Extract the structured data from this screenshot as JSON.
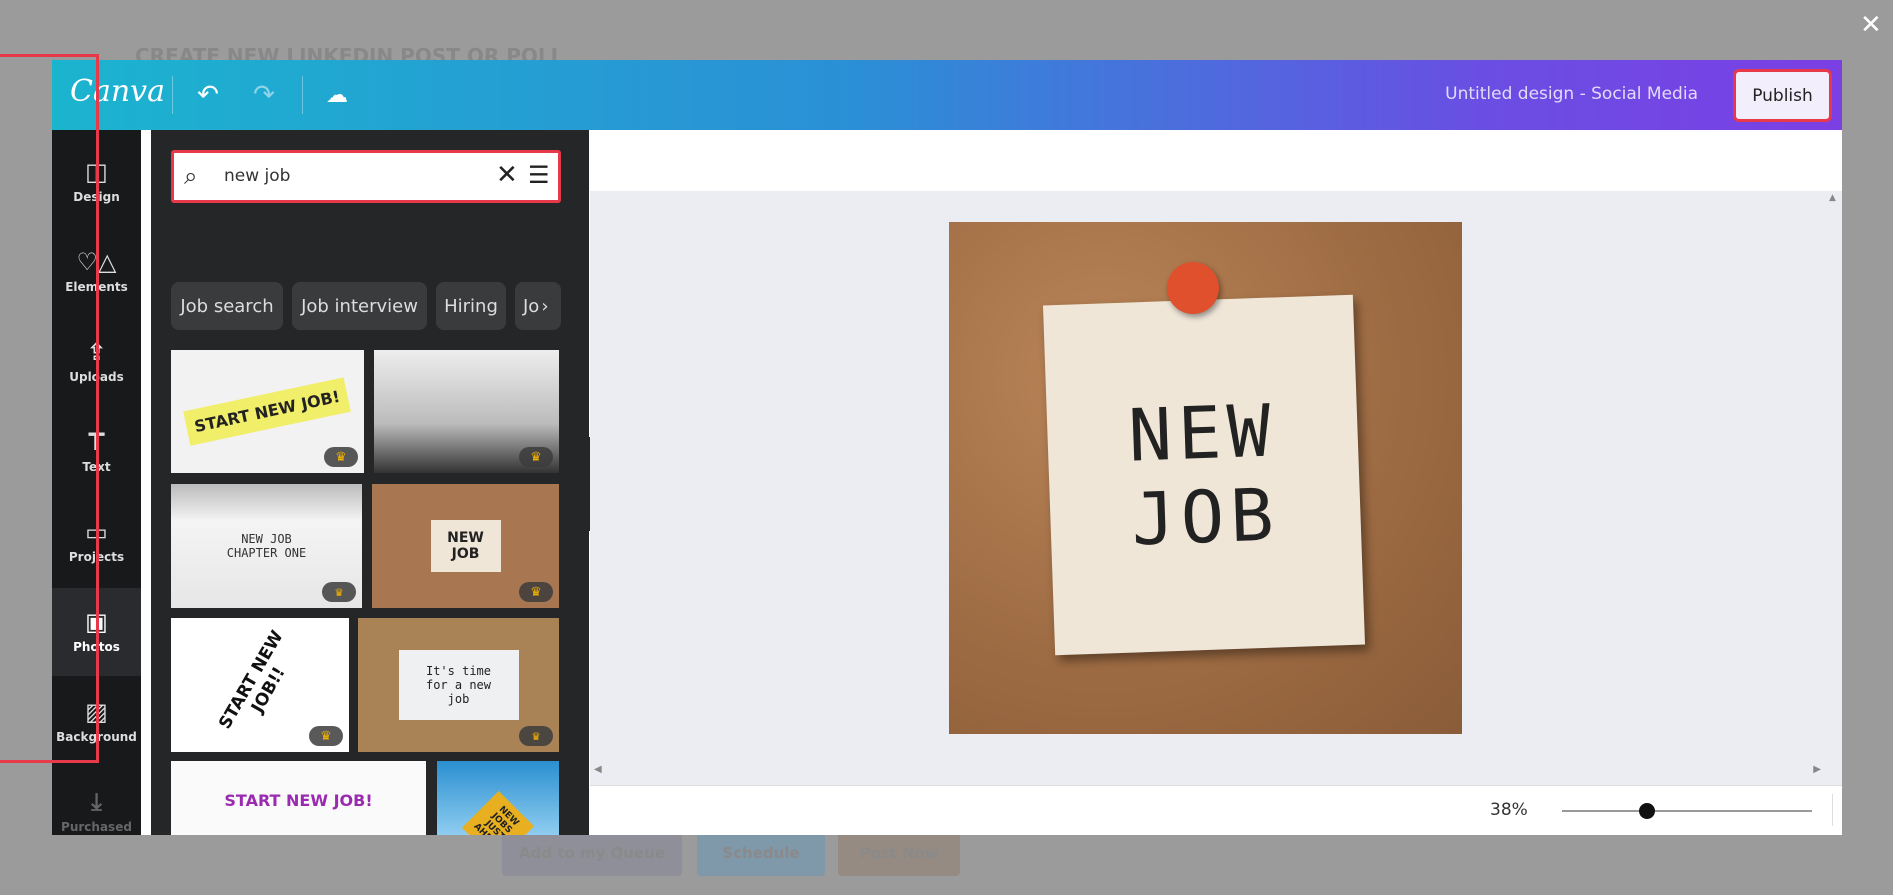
{
  "background_app": {
    "page_title": "CREATE NEW LINKEDIN POST OR POLL",
    "buttons": [
      "Add to my Queue",
      "Schedule",
      "Post Now"
    ]
  },
  "close_icon": "close-icon",
  "header": {
    "logo": "Canva",
    "title": "Untitled design - Social Media",
    "publish": "Publish",
    "icons": [
      "undo-icon",
      "redo-icon",
      "cloud-saved-icon"
    ]
  },
  "rail": {
    "items": [
      {
        "label": "Design",
        "icon": "layout-icon"
      },
      {
        "label": "Elements",
        "icon": "shapes-icon"
      },
      {
        "label": "Uploads",
        "icon": "cloud-upload-icon"
      },
      {
        "label": "Text",
        "icon": "text-icon"
      },
      {
        "label": "Projects",
        "icon": "folder-icon"
      },
      {
        "label": "Photos",
        "icon": "image-icon",
        "active": true
      },
      {
        "label": "Background",
        "icon": "stripes-icon"
      },
      {
        "label": "Purchased",
        "icon": "download-icon"
      }
    ]
  },
  "search": {
    "value": "new job",
    "icons": [
      "search-icon",
      "clear-icon",
      "filter-icon"
    ]
  },
  "chips": [
    "Job search",
    "Job interview",
    "Hiring",
    "Jo"
  ],
  "photos": [
    {
      "text": "START NEW JOB!",
      "premium": true
    },
    {
      "text": "",
      "premium": true
    },
    {
      "text": "NEW JOB CHAPTER ONE",
      "premium": true
    },
    {
      "text": "NEW JOB",
      "premium": true
    },
    {
      "text": "START NEW JOB!!",
      "premium": true
    },
    {
      "text": "It's time for a new job",
      "premium": true
    },
    {
      "text": "START NEW JOB!",
      "premium": false
    },
    {
      "text": "NEW JOBS JUST AHEAD",
      "premium": false
    }
  ],
  "canvas": {
    "note_line1": "NEW",
    "note_line2": "JOB"
  },
  "bottom": {
    "zoom": "38%",
    "zoom_percent": 38,
    "help": "?"
  }
}
